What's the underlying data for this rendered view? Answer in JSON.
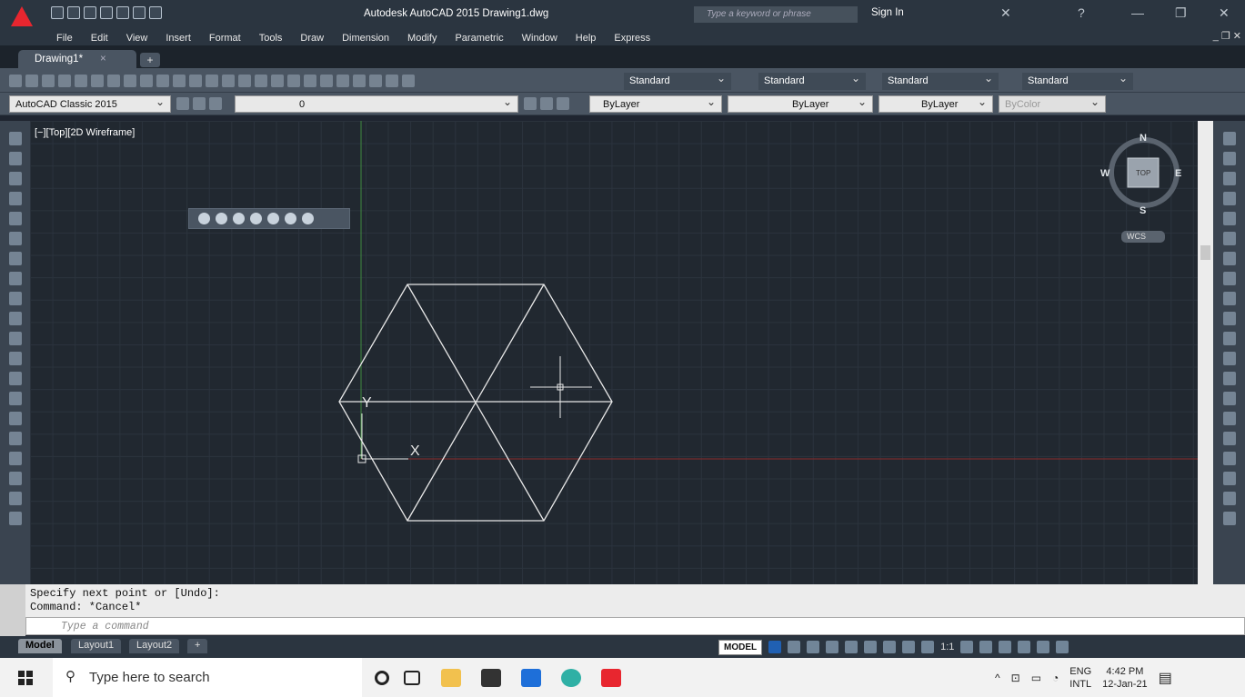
{
  "app": {
    "title": "Autodesk AutoCAD 2015   Drawing1.dwg",
    "search_placeholder": "Type a keyword or phrase",
    "sign_in": "Sign In"
  },
  "menu": [
    "File",
    "Edit",
    "View",
    "Insert",
    "Format",
    "Tools",
    "Draw",
    "Dimension",
    "Modify",
    "Parametric",
    "Window",
    "Help",
    "Express"
  ],
  "doc_tab": {
    "label": "Drawing1*",
    "close": "×",
    "new": "+"
  },
  "toolbar1": {
    "styles": [
      "Standard",
      "Standard",
      "Standard",
      "Standard"
    ]
  },
  "toolbar2": {
    "workspace": "AutoCAD Classic 2015",
    "layer": "0",
    "color": "ByLayer",
    "linetype": "ByLayer",
    "lineweight": "ByLayer",
    "plotstyle": "ByColor"
  },
  "viewport": {
    "label": "[−][Top][2D Wireframe]",
    "ucs_x": "X",
    "ucs_y": "Y"
  },
  "viewcube": {
    "n": "N",
    "s": "S",
    "e": "E",
    "w": "W",
    "face": "TOP",
    "wcs": "WCS"
  },
  "command": {
    "history1": "Specify next point or [Undo]:",
    "history2": "Command: *Cancel*",
    "prompt": "Type a command"
  },
  "layouts": [
    "Model",
    "Layout1",
    "Layout2",
    "+"
  ],
  "status": {
    "model": "MODEL",
    "scale": "1:1"
  },
  "taskbar": {
    "search": "Type here to search",
    "lang1": "ENG",
    "lang2": "INTL",
    "time": "4:42 PM",
    "date": "12-Jan-21"
  },
  "colors": {
    "ribbon": "#4a5562",
    "canvas": "#212830",
    "logo": "#e8262f"
  }
}
